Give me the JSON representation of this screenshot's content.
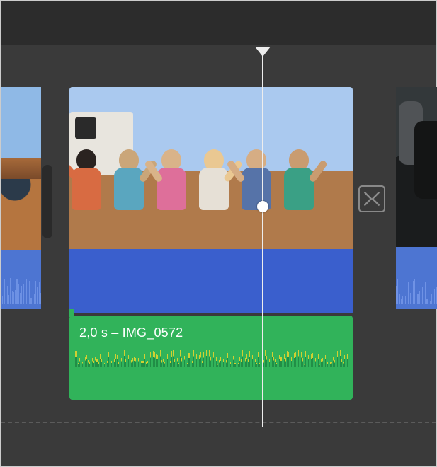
{
  "audio_clip": {
    "label": "2,0 s – IMG_0572"
  },
  "transition": {
    "icon_name": "cross-dissolve-icon"
  }
}
